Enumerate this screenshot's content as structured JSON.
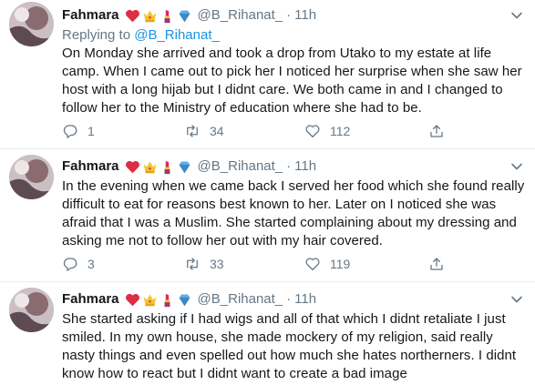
{
  "colors": {
    "link": "#1b95e0",
    "muted": "#657786",
    "text": "#14171a",
    "border": "#e6ecf0"
  },
  "tweets": [
    {
      "name": "Fahmara",
      "emojis": [
        "red-heart-emoji",
        "crown-emoji",
        "lipstick-emoji",
        "gem-emoji"
      ],
      "handle": "@B_Rihanat_",
      "sep": "·",
      "time": "11h",
      "replying_label": "Replying to",
      "replying_to": "@B_Rihanat_",
      "text": "On Monday she arrived and took a drop from Utako to my estate at life camp. When I came out to pick her I noticed her surprise when she saw her host with a long hijab but I didnt care. We both came in and I changed to follow her to the Ministry of education where she had to be.",
      "replies": "1",
      "retweets": "34",
      "likes": "112"
    },
    {
      "name": "Fahmara",
      "emojis": [
        "red-heart-emoji",
        "crown-emoji",
        "lipstick-emoji",
        "gem-emoji"
      ],
      "handle": "@B_Rihanat_",
      "sep": "·",
      "time": "11h",
      "text": "In the evening when we came back I served her food which she found really difficult to eat for reasons best known to her. Later on I noticed she was afraid that I was a Muslim. She started complaining about my dressing and asking me not to follow her out with my hair covered.",
      "replies": "3",
      "retweets": "33",
      "likes": "119"
    },
    {
      "name": "Fahmara",
      "emojis": [
        "red-heart-emoji",
        "crown-emoji",
        "lipstick-emoji",
        "gem-emoji"
      ],
      "handle": "@B_Rihanat_",
      "sep": "·",
      "time": "11h",
      "text": "She started asking if I had wigs and all of that which I didnt retaliate I just smiled. In my own house, she made mockery of my religion, said really nasty things and even spelled out how much she hates northerners. I didnt know how to react but I didnt want to create a bad image"
    }
  ]
}
